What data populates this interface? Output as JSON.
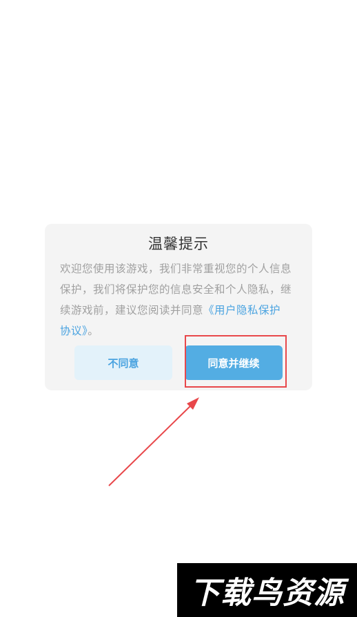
{
  "dialog": {
    "title": "温馨提示",
    "body_text": "欢迎您使用该游戏，我们非常重视您的个人信息保护，我们将保护您的信息安全和个人隐私，继续游戏前，建议您阅读并同意",
    "link_text": "《用户隐私保护协议》",
    "body_end": "。",
    "disagree_label": "不同意",
    "agree_label": "同意并继续"
  },
  "colors": {
    "accent": "#53ade3",
    "link": "#4aa3e0",
    "annotation": "#e8474a"
  },
  "watermark": {
    "text": "下载鸟资源"
  }
}
